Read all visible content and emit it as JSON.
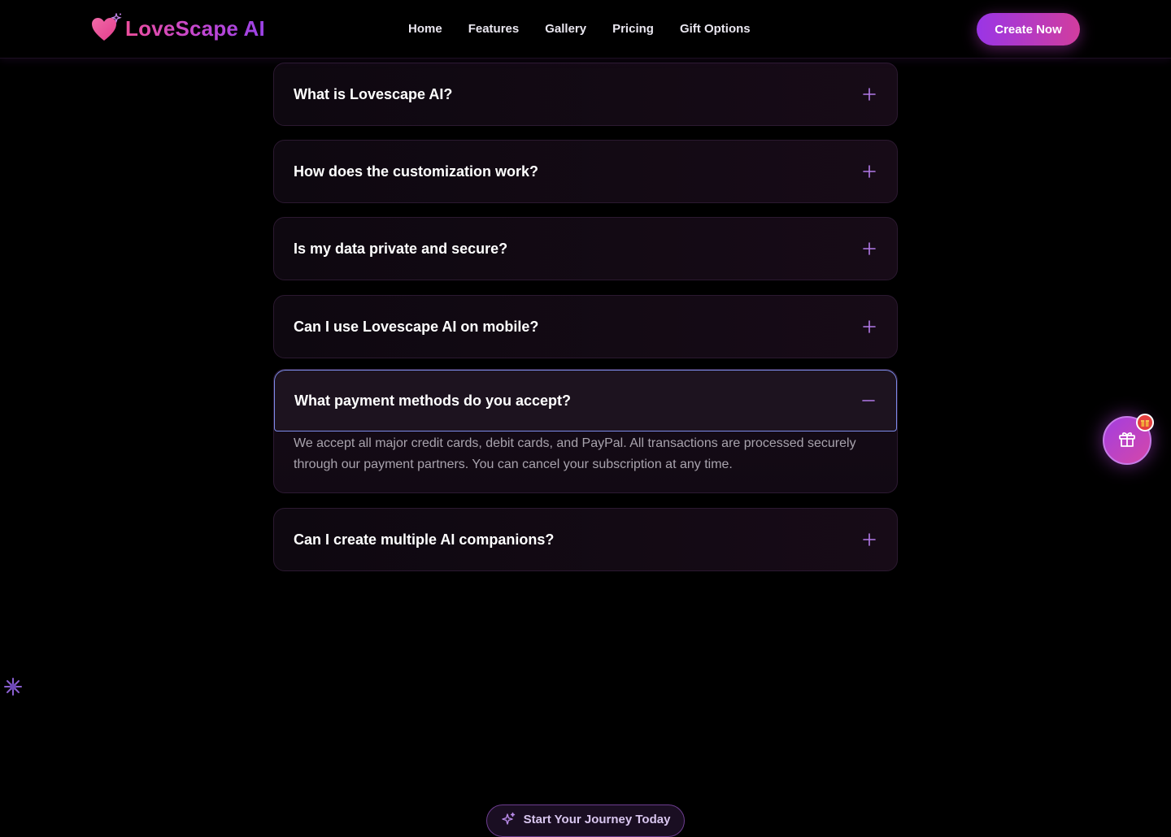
{
  "brand": {
    "name": "LoveScape AI",
    "logo_icon": "heart-sparkle-icon"
  },
  "nav": {
    "items": [
      {
        "label": "Home"
      },
      {
        "label": "Features"
      },
      {
        "label": "Gallery"
      },
      {
        "label": "Pricing"
      },
      {
        "label": "Gift Options"
      }
    ],
    "cta_label": "Create Now"
  },
  "faq": {
    "items": [
      {
        "question": "What is Lovescape AI?",
        "icon": "plus-icon",
        "open": false
      },
      {
        "question": "How does the customization work?",
        "icon": "plus-icon",
        "open": false
      },
      {
        "question": "Is my data private and secure?",
        "icon": "plus-icon",
        "open": false
      },
      {
        "question": "Can I use Lovescape AI on mobile?",
        "icon": "plus-icon",
        "open": false
      },
      {
        "question": "What payment methods do you accept?",
        "icon": "minus-icon",
        "open": true,
        "answer": "We accept all major credit cards, debit cards, and PayPal. All transactions are processed securely through our payment partners. You can cancel your subscription at any time."
      },
      {
        "question": "Can I create multiple AI companions?",
        "icon": "plus-icon",
        "open": false
      }
    ]
  },
  "gift_button": {
    "icon": "gift-icon",
    "badge_icon": "gift-emoji-icon"
  },
  "journey_button": {
    "label": "Start Your Journey Today",
    "icon": "sparkle-icon"
  },
  "colors": {
    "background": "#000000",
    "accent_purple": "#9a35e6",
    "accent_pink": "#d13d9e",
    "toggle_icon": "#b27ae8",
    "focus_outline": "#7c8be8"
  }
}
